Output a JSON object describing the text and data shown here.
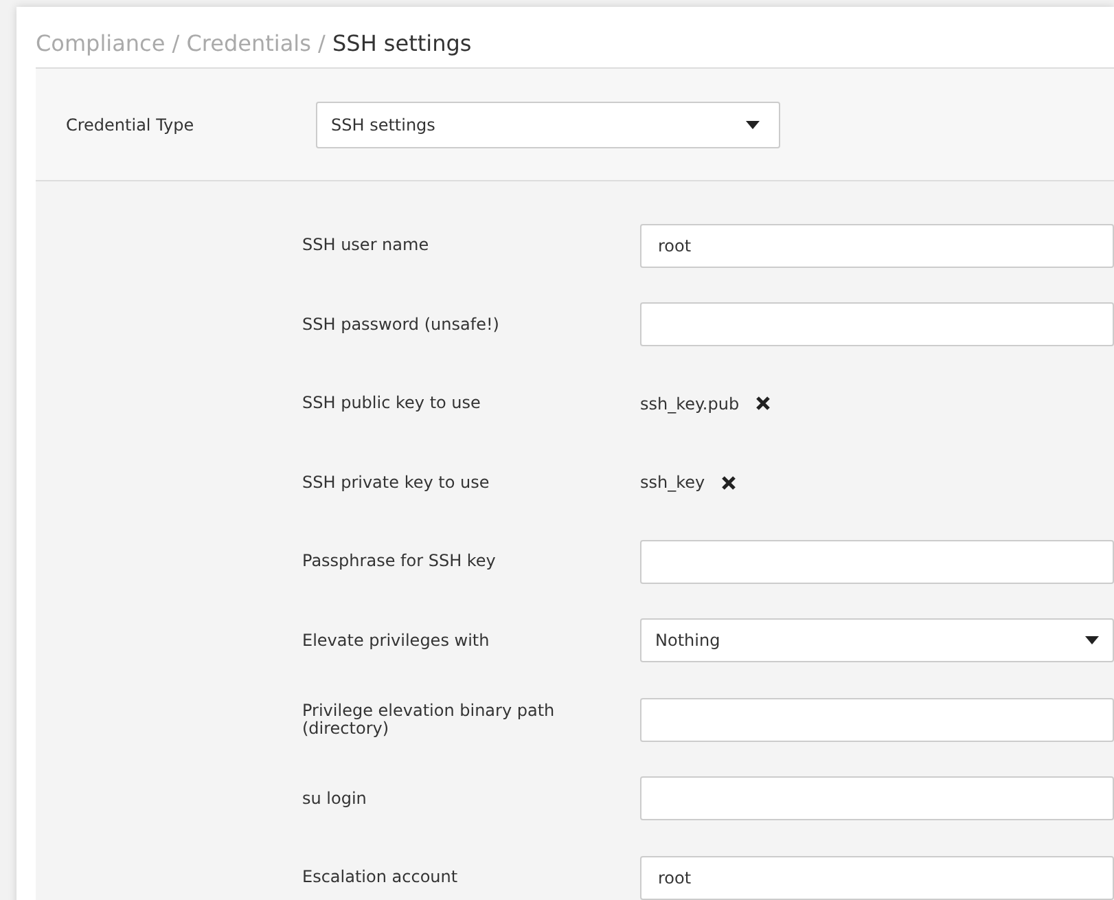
{
  "breadcrumb": [
    {
      "label": "Compliance",
      "current": false
    },
    {
      "label": "Credentials",
      "current": false
    },
    {
      "label": "SSH settings",
      "current": true
    }
  ],
  "separator": "/",
  "credential_type": {
    "label": "Credential Type",
    "value": "SSH settings"
  },
  "fields": [
    {
      "kind": "text",
      "label": "SSH user name",
      "value": "root"
    },
    {
      "kind": "text",
      "label": "SSH password (unsafe!)"
    },
    {
      "kind": "file",
      "label": "SSH public key to use",
      "value": "ssh_key.pub"
    },
    {
      "kind": "file",
      "label": "SSH private key to use",
      "value": "ssh_key"
    },
    {
      "kind": "text",
      "label": "Passphrase for SSH key"
    },
    {
      "kind": "select",
      "label": "Elevate privileges with",
      "value": "Nothing"
    },
    {
      "kind": "text",
      "label": "Privilege elevation binary path (directory)"
    },
    {
      "kind": "text",
      "label": "su login"
    },
    {
      "kind": "text",
      "label": "Escalation account",
      "value": "root"
    }
  ]
}
